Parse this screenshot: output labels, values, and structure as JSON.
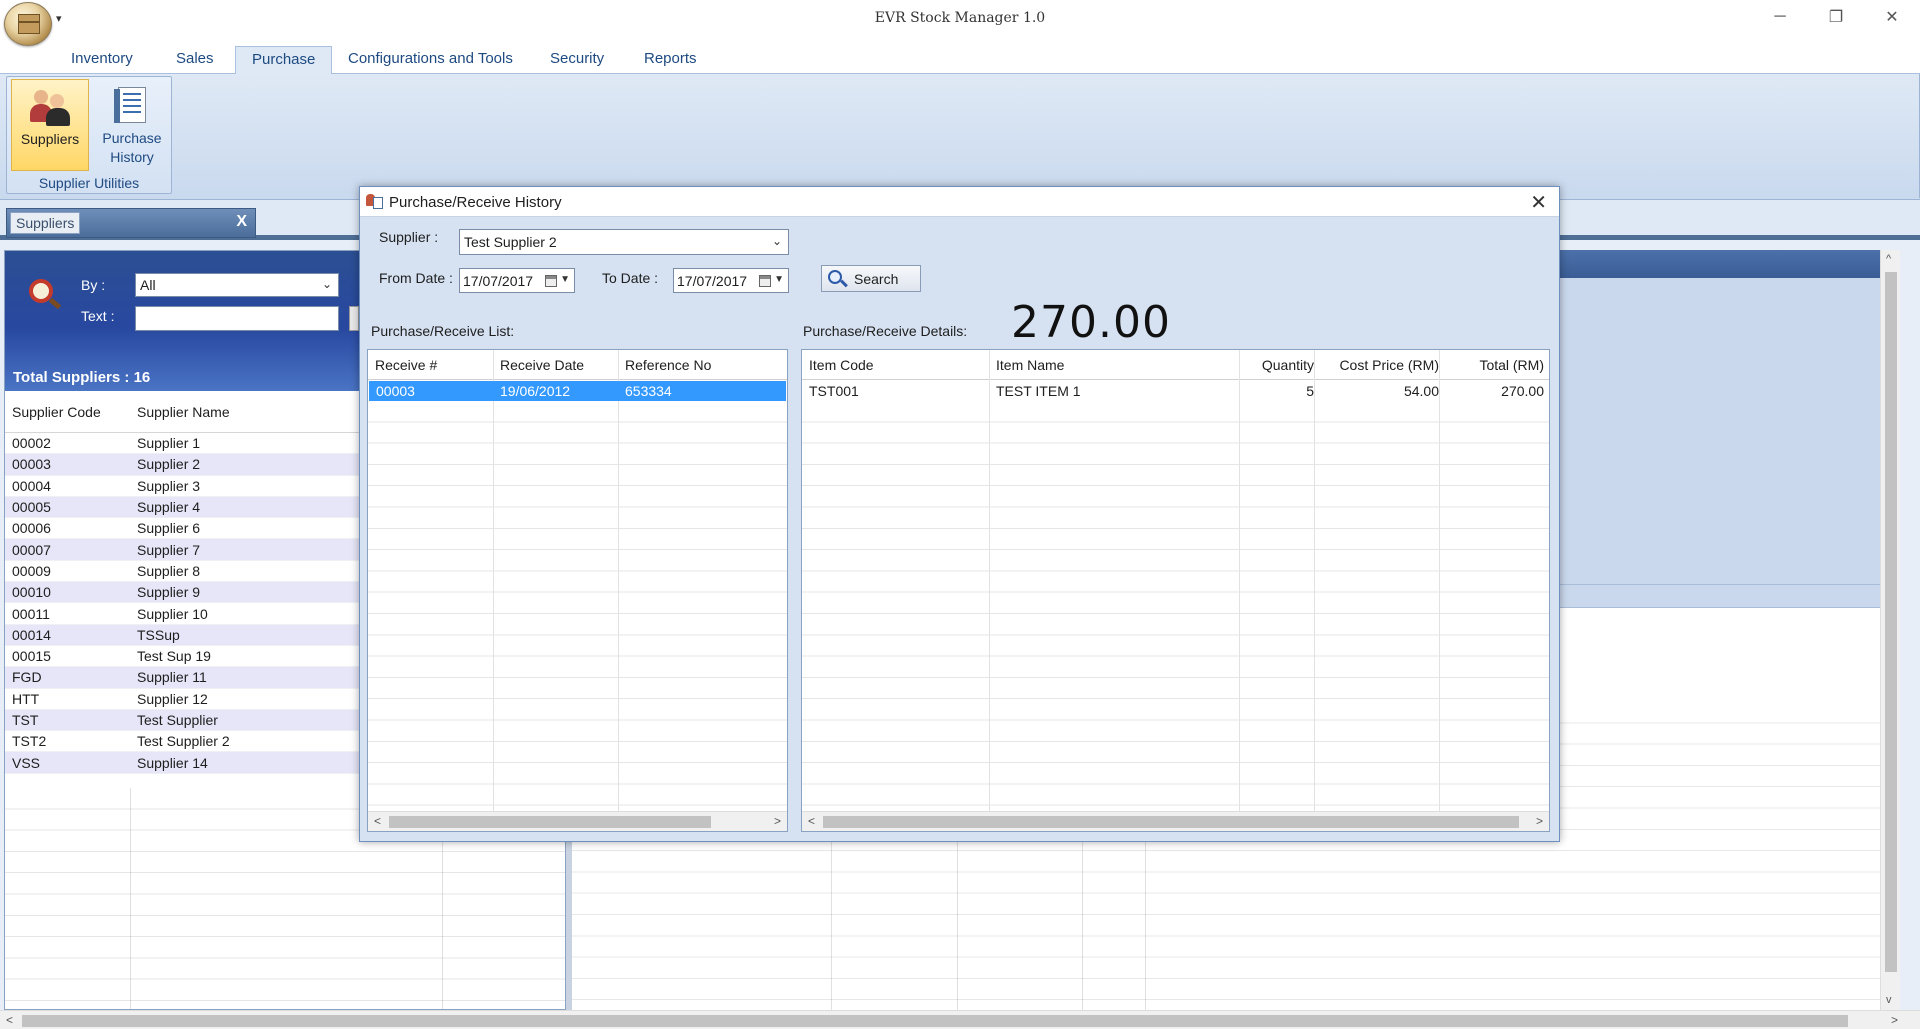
{
  "app": {
    "title": "EVR Stock Manager 1.0",
    "qat_arrow": "▾",
    "controls": {
      "minimize": "─",
      "restore": "❐",
      "close": "✕"
    }
  },
  "ribbon": {
    "tabs": [
      "Inventory",
      "Sales",
      "Purchase",
      "Configurations and Tools",
      "Security",
      "Reports"
    ],
    "active_tab": "Purchase",
    "group": {
      "label": "Supplier Utilities",
      "buttons": [
        {
          "label": "Suppliers",
          "icon": "suppliers-icon"
        },
        {
          "label": "Purchase History",
          "icon": "purchase-history-icon"
        }
      ]
    }
  },
  "doc_tab": {
    "label": "Suppliers",
    "close": "X"
  },
  "supplier_panel": {
    "by_label": "By :",
    "by_value": "All",
    "text_label": "Text :",
    "text_value": "",
    "total": "Total Suppliers : 16",
    "columns": [
      "Supplier Code",
      "Supplier Name"
    ],
    "rows": [
      [
        "00002",
        "Supplier 1"
      ],
      [
        "00003",
        "Supplier 2"
      ],
      [
        "00004",
        "Supplier 3"
      ],
      [
        "00005",
        "Supplier 4"
      ],
      [
        "00006",
        "Supplier 6"
      ],
      [
        "00007",
        "Supplier 7"
      ],
      [
        "00009",
        "Supplier 8"
      ],
      [
        "00010",
        "Supplier 9"
      ],
      [
        "00011",
        "Supplier 10"
      ],
      [
        "00014",
        "TSSup"
      ],
      [
        "00015",
        "Test Sup 19"
      ],
      [
        "FGD",
        "Supplier 11"
      ],
      [
        "HTT",
        "Supplier 12"
      ],
      [
        "TST",
        "Test Supplier"
      ],
      [
        "TST2",
        "Test Supplier 2"
      ],
      [
        "VSS",
        "Supplier 14"
      ]
    ]
  },
  "dialog": {
    "title": "Purchase/Receive History",
    "close": "✕",
    "supplier_label": "Supplier :",
    "supplier_value": "Test Supplier 2",
    "from_label": "From Date :",
    "from_value": "17/07/2017",
    "to_label": "To Date :",
    "to_value": "17/07/2017",
    "search_label": "Search",
    "list_label": "Purchase/Receive List:",
    "details_label": "Purchase/Receive Details:",
    "grand_total": "270.00",
    "list_columns": [
      "Receive #",
      "Receive Date",
      "Reference No"
    ],
    "list_rows": [
      [
        "00003",
        "19/06/2012",
        "653334"
      ]
    ],
    "detail_columns": [
      "Item Code",
      "Item Name",
      "Quantity",
      "Cost Price (RM)",
      "Total (RM)"
    ],
    "detail_rows": [
      [
        "TST001",
        "TEST ITEM 1",
        "5",
        "54.00",
        "270.00"
      ]
    ]
  },
  "scroll": {
    "left": "<",
    "right": ">",
    "up": "^",
    "down": "v"
  }
}
